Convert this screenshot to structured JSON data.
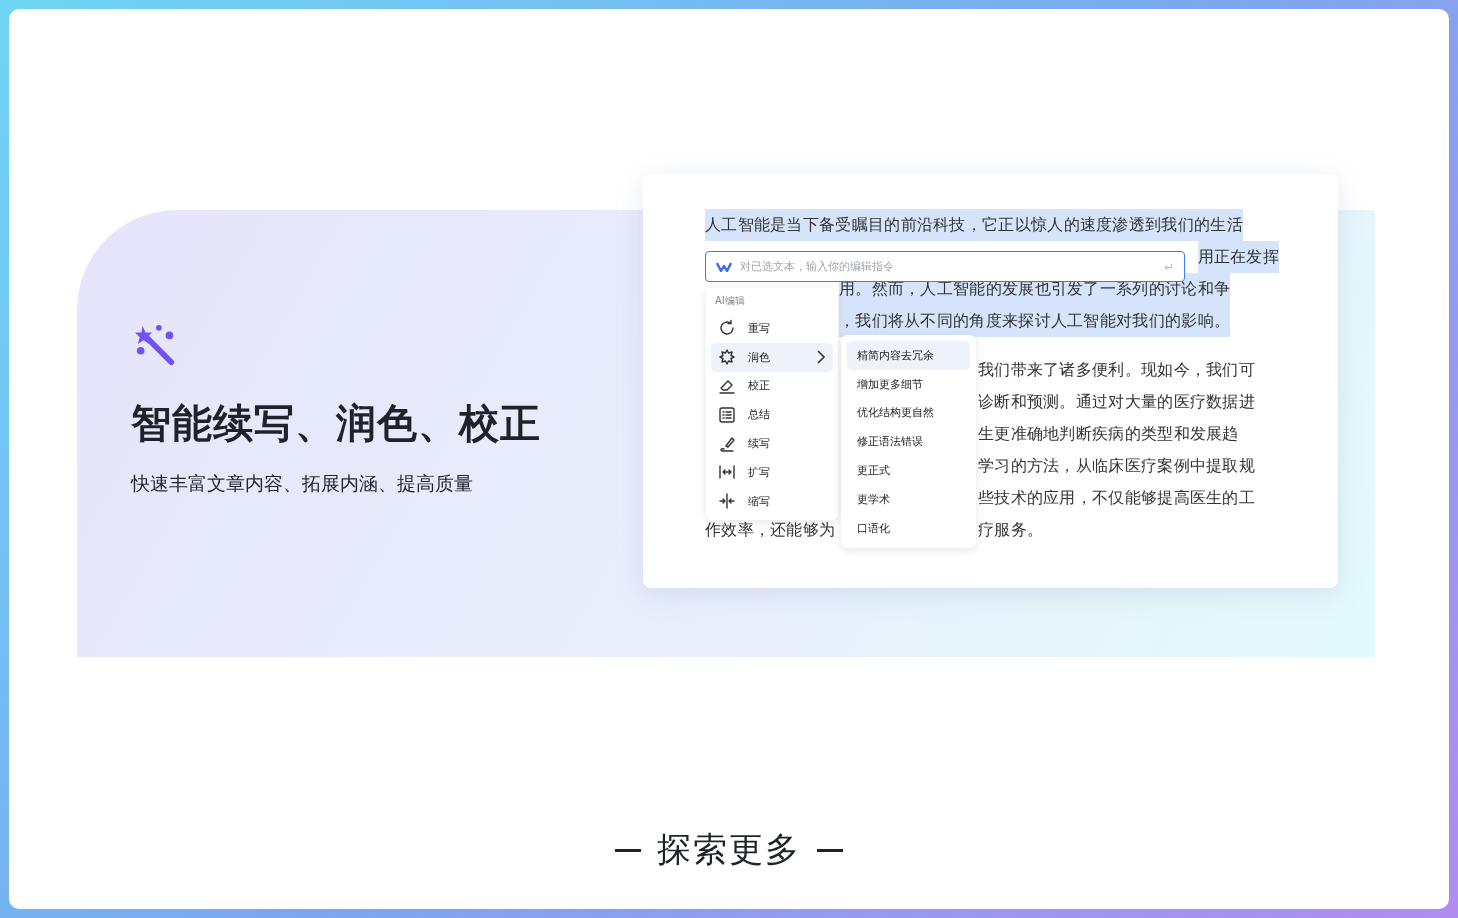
{
  "feature": {
    "title": "智能续写、润色、校正",
    "subtitle": "快速丰富文章内容、拓展内涵、提高质量"
  },
  "document": {
    "paragraphs": [
      {
        "lines": [
          {
            "kind": "full",
            "highlighted": true,
            "text": "人工智能是当下备受瞩目的前沿科技，它正以惊人的速度渗透到我们的生活"
          },
          {
            "kind": "right",
            "highlighted": true,
            "text": "用正在发挥"
          },
          {
            "kind": "after_menu",
            "highlighted": true,
            "text": "用。然而，人工智能的发展也引发了一系列的讨论和争"
          },
          {
            "kind": "after_menu",
            "highlighted": true,
            "text": "，我们将从不同的角度来探讨人工智能对我们的影响。"
          }
        ]
      },
      {
        "lines": [
          {
            "kind": "after_submenu",
            "highlighted": false,
            "text": "我们带来了诸多便利。现如今，我们可"
          },
          {
            "kind": "after_submenu",
            "highlighted": false,
            "text": "诊断和预测。通过对大量的医疗数据进"
          },
          {
            "kind": "after_submenu",
            "highlighted": false,
            "text": "生更准确地判断疾病的类型和发展趋"
          },
          {
            "kind": "after_submenu",
            "highlighted": false,
            "text": "学习的方法，从临床医疗案例中提取规"
          },
          {
            "kind": "after_submenu",
            "highlighted": false,
            "text": "些技术的应用，不仅能够提高医生的工"
          },
          {
            "kind": "split",
            "highlighted": false,
            "text": "作效率，还能够为",
            "text_right": "疗服务。"
          }
        ]
      }
    ]
  },
  "command_field": {
    "placeholder": "对已选文本，输入你的编辑指令",
    "submit_glyph": "↵"
  },
  "ai_menu": {
    "heading": "AI编辑",
    "items": [
      {
        "kind": "rewrite",
        "label": "重写",
        "selected": false,
        "has_submenu": false
      },
      {
        "kind": "polish",
        "label": "润色",
        "selected": true,
        "has_submenu": true
      },
      {
        "kind": "proofread",
        "label": "校正",
        "selected": false,
        "has_submenu": false
      },
      {
        "kind": "summary",
        "label": "总结",
        "selected": false,
        "has_submenu": false
      },
      {
        "kind": "continue",
        "label": "续写",
        "selected": false,
        "has_submenu": false
      },
      {
        "kind": "expand",
        "label": "扩写",
        "selected": false,
        "has_submenu": false
      },
      {
        "kind": "shrink",
        "label": "缩写",
        "selected": false,
        "has_submenu": false
      }
    ]
  },
  "polish_submenu": {
    "items": [
      {
        "label": "精简内容去冗余",
        "selected": true
      },
      {
        "label": "增加更多细节",
        "selected": false
      },
      {
        "label": "优化结构更自然",
        "selected": false
      },
      {
        "label": "修正语法错误",
        "selected": false
      },
      {
        "label": "更正式",
        "selected": false
      },
      {
        "label": "更学术",
        "selected": false
      },
      {
        "label": "口语化",
        "selected": false
      }
    ]
  },
  "explore_more": {
    "label": "探索更多"
  }
}
